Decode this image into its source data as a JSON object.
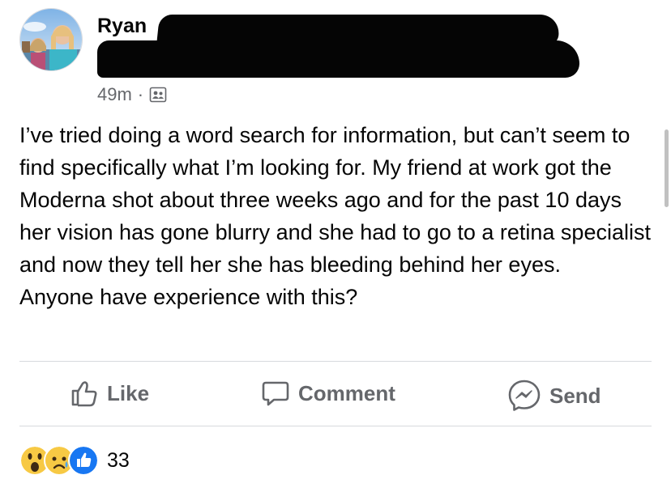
{
  "post": {
    "author_name": "Ryan",
    "time": "49m",
    "separator": "·",
    "privacy_icon": "group-privacy-icon",
    "text_lines": [
      "I’ve tried doing a word search for information, but can’t seem to find specifically what I’m looking for. My friend at work got the Moderna shot about three weeks ago and for the past 10 days her vision has gone blurry and she had to go to a retina specialist and now they tell her she has bleeding behind her eyes.",
      "Anyone have experience with this?"
    ]
  },
  "actions": {
    "like_label": "Like",
    "comment_label": "Comment",
    "send_label": "Send"
  },
  "reactions": {
    "icons": [
      "wow-reaction-icon",
      "sad-reaction-icon",
      "like-reaction-icon"
    ],
    "count": "33"
  },
  "colors": {
    "text": "#050505",
    "secondary": "#65676b",
    "like_blue": "#1877f2",
    "emoji_yellow": "#f7c944"
  }
}
